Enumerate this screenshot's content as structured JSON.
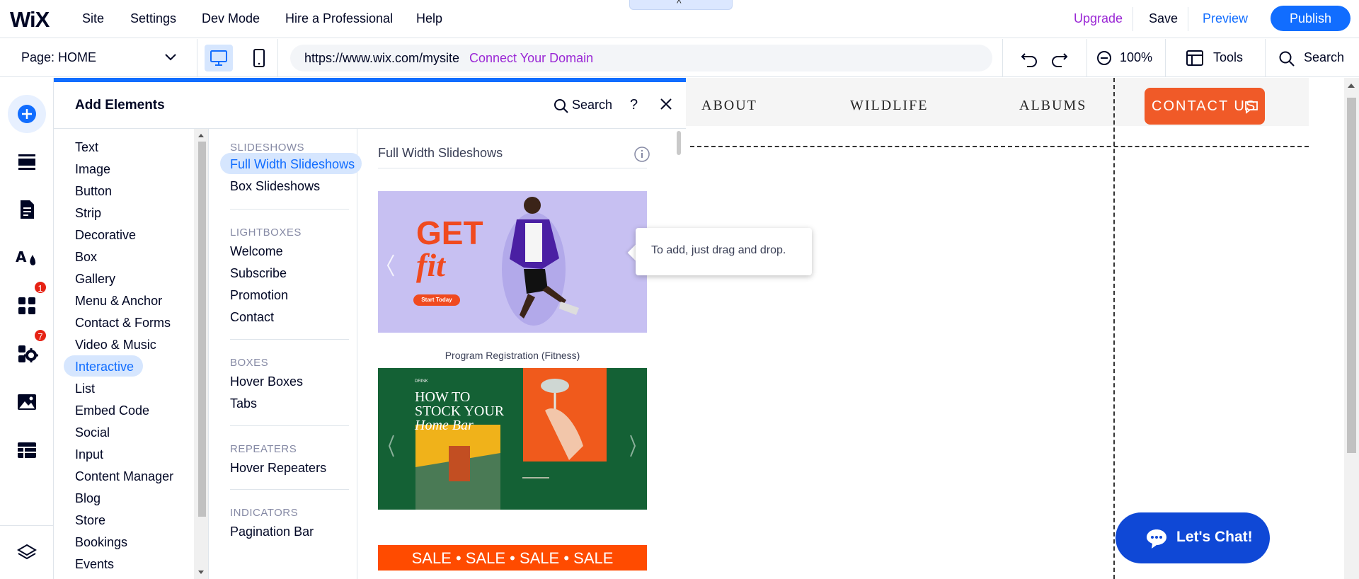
{
  "topbar": {
    "logo": "WiX",
    "menu": [
      "Site",
      "Settings",
      "Dev Mode",
      "Hire a Professional",
      "Help"
    ],
    "upgrade": "Upgrade",
    "save": "Save",
    "preview": "Preview",
    "publish": "Publish",
    "collapse_icon": "^"
  },
  "secondbar": {
    "page_label": "Page: HOME",
    "url": "https://www.wix.com/mysite",
    "connect_domain": "Connect Your Domain",
    "zoom": "100%",
    "tools": "Tools",
    "search": "Search"
  },
  "leftbar": {
    "icons": [
      "add-icon",
      "sections-icon",
      "pages-icon",
      "theme-icon",
      "apps-icon",
      "business-apps-icon",
      "media-icon",
      "cms-icon",
      "layers-icon"
    ],
    "badges": {
      "apps": "1",
      "business_apps": "7"
    }
  },
  "panel": {
    "title": "Add Elements",
    "search": "Search",
    "help": "?",
    "categories": [
      "Text",
      "Image",
      "Button",
      "Strip",
      "Decorative",
      "Box",
      "Gallery",
      "Menu & Anchor",
      "Contact & Forms",
      "Video & Music",
      "Interactive",
      "List",
      "Embed Code",
      "Social",
      "Input",
      "Content Manager",
      "Blog",
      "Store",
      "Bookings",
      "Events"
    ],
    "active_category": "Interactive",
    "subgroups": {
      "slideshows": {
        "head": "SLIDESHOWS",
        "items": [
          "Full Width Slideshows",
          "Box Slideshows"
        ]
      },
      "lightboxes": {
        "head": "LIGHTBOXES",
        "items": [
          "Welcome",
          "Subscribe",
          "Promotion",
          "Contact"
        ]
      },
      "boxes": {
        "head": "BOXES",
        "items": [
          "Hover Boxes",
          "Tabs"
        ]
      },
      "repeaters": {
        "head": "REPEATERS",
        "items": [
          "Hover Repeaters"
        ]
      },
      "indicators": {
        "head": "INDICATORS",
        "items": [
          "Pagination Bar"
        ]
      }
    },
    "preview_title": "Full Width Slideshows",
    "cards": {
      "fitness": {
        "caption": "Program Registration (Fitness)",
        "get": "GET",
        "fit": "fit",
        "cta": "Start Today"
      },
      "bar": {
        "small": "DRINK",
        "line1": "HOW TO",
        "line2": "STOCK YOUR",
        "line3": "Home Bar"
      },
      "sale": {
        "text": "SALE • SALE • SALE • SALE"
      }
    }
  },
  "tooltip": "To add, just drag and drop.",
  "site": {
    "nav": [
      "ABOUT",
      "WILDLIFE",
      "ALBUMS"
    ],
    "contact": "CONTACT US",
    "chat": "Let's Chat!"
  },
  "colors": {
    "accent": "#116dff",
    "upgrade": "#9a27d5",
    "contact": "#f05a28",
    "chat": "#0f48d6"
  }
}
